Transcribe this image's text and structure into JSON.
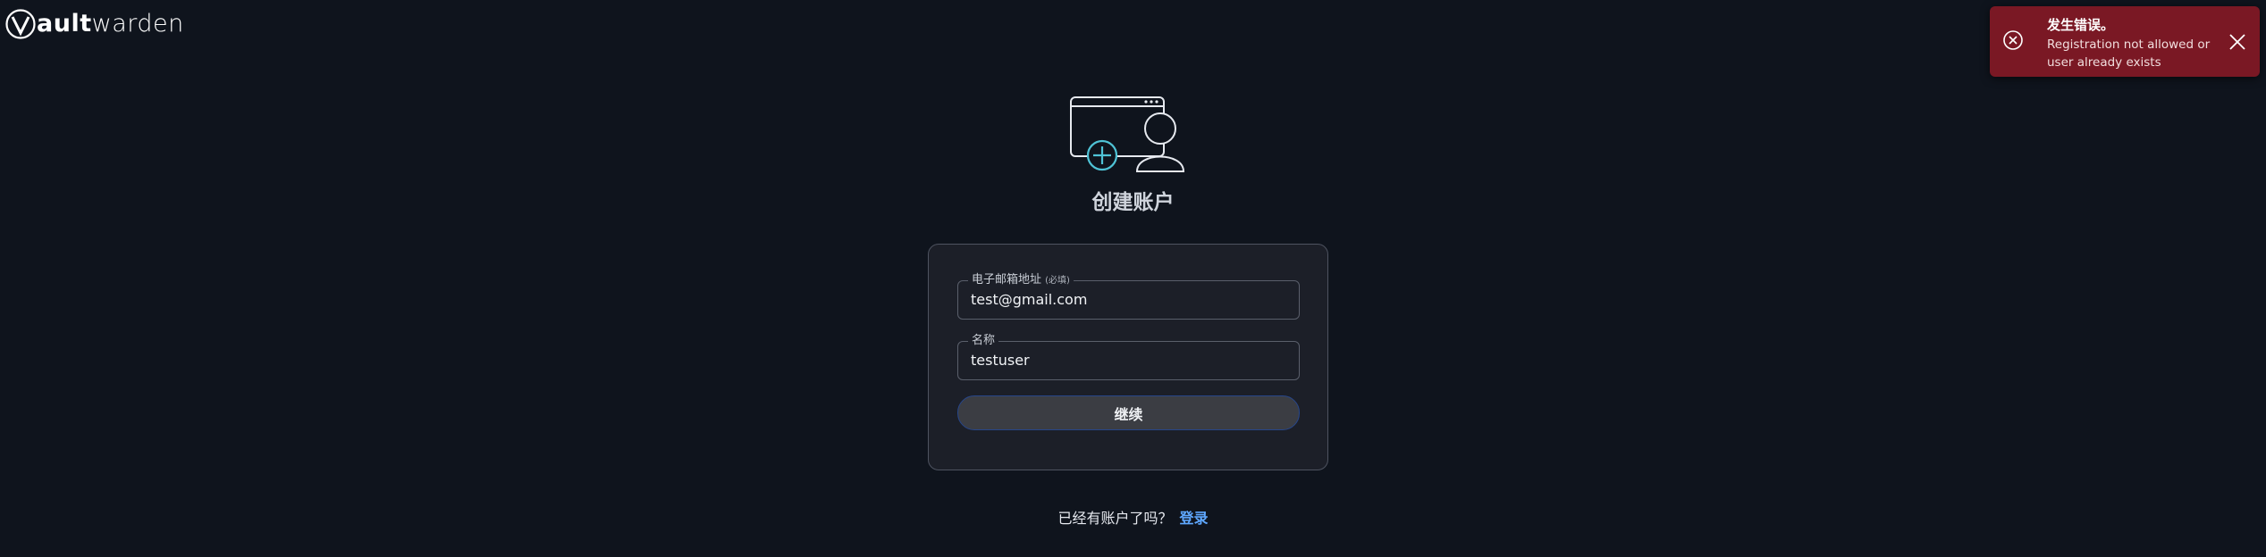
{
  "logo": {
    "bold": "V",
    "strong": "ault",
    "light": "warden"
  },
  "toast": {
    "title": "发生错误。",
    "message": "Registration not allowed or user already exists",
    "color": "#7a1824"
  },
  "page": {
    "title": "创建账户"
  },
  "form": {
    "email": {
      "label": "电子邮箱地址",
      "required_note": "(必填)",
      "value": "test@gmail.com"
    },
    "name": {
      "label": "名称",
      "value": "testuser"
    },
    "continue_label": "继续"
  },
  "footer": {
    "prompt": "已经有账户了吗？",
    "login_link": "登录"
  },
  "icons": {
    "logo": "vaultwarden-shield-icon",
    "error": "error-circle-x-icon",
    "close": "close-icon",
    "illustration": "create-account-illustration"
  },
  "colors": {
    "background": "#0f141d",
    "link": "#5fa8ff",
    "accent": "#4fc3d6"
  }
}
